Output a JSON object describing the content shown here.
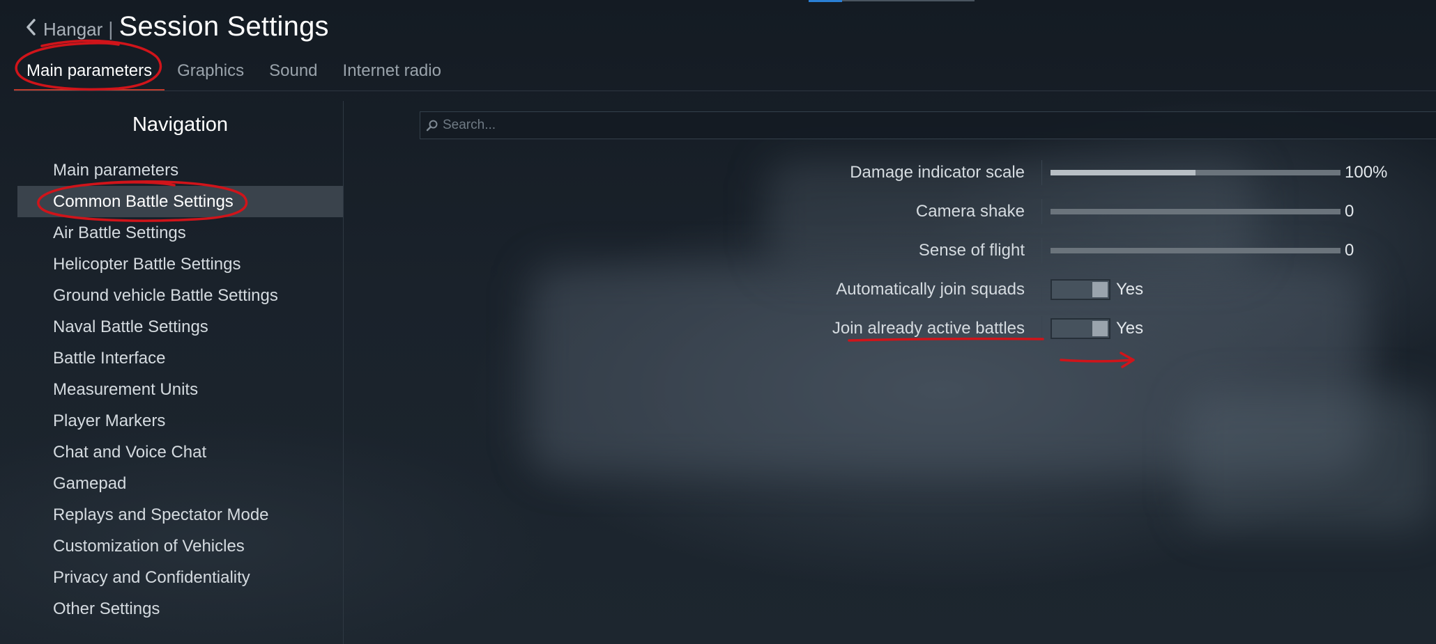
{
  "header": {
    "back_label": "Hangar",
    "separator": "|",
    "title": "Session Settings"
  },
  "tabs": [
    {
      "label": "Main parameters",
      "active": true
    },
    {
      "label": "Graphics",
      "active": false
    },
    {
      "label": "Sound",
      "active": false
    },
    {
      "label": "Internet radio",
      "active": false
    }
  ],
  "navigation": {
    "title": "Navigation",
    "items": [
      {
        "label": "Main parameters",
        "selected": false
      },
      {
        "label": "Common Battle Settings",
        "selected": true
      },
      {
        "label": "Air Battle Settings",
        "selected": false
      },
      {
        "label": "Helicopter Battle Settings",
        "selected": false
      },
      {
        "label": "Ground vehicle Battle Settings",
        "selected": false
      },
      {
        "label": "Naval Battle Settings",
        "selected": false
      },
      {
        "label": "Battle Interface",
        "selected": false
      },
      {
        "label": "Measurement Units",
        "selected": false
      },
      {
        "label": "Player Markers",
        "selected": false
      },
      {
        "label": "Chat and Voice Chat",
        "selected": false
      },
      {
        "label": "Gamepad",
        "selected": false
      },
      {
        "label": "Replays and Spectator Mode",
        "selected": false
      },
      {
        "label": "Customization of Vehicles",
        "selected": false
      },
      {
        "label": "Privacy and Confidentiality",
        "selected": false
      },
      {
        "label": "Other Settings",
        "selected": false
      }
    ]
  },
  "search": {
    "placeholder": "Search..."
  },
  "settings": [
    {
      "label": "Damage indicator scale",
      "type": "slider",
      "value_text": "100%",
      "fill_fraction": 0.5
    },
    {
      "label": "Camera shake",
      "type": "slider",
      "value_text": "0",
      "fill_fraction": 0
    },
    {
      "label": "Sense of flight",
      "type": "slider",
      "value_text": "0",
      "fill_fraction": 0
    },
    {
      "label": "Automatically join squads",
      "type": "toggle",
      "value_text": "Yes",
      "on": true
    },
    {
      "label": "Join already active battles",
      "type": "toggle",
      "value_text": "Yes",
      "on": true
    }
  ],
  "colors": {
    "annotation_red": "#d0141a",
    "selected_nav_bg": "#3a434c",
    "accent_blue": "#2a7fd4"
  },
  "icons": {
    "back": "chevron-left-icon",
    "search": "search-icon"
  }
}
